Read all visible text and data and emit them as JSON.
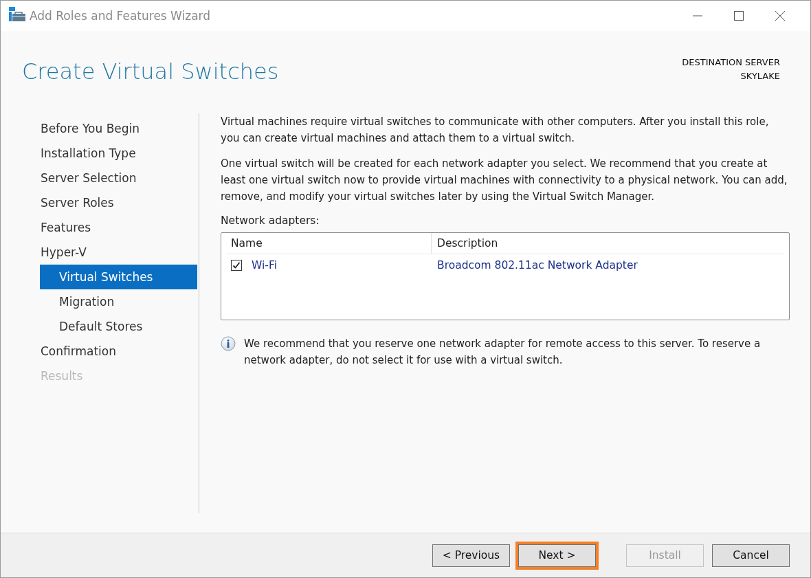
{
  "window": {
    "title": "Add Roles and Features Wizard"
  },
  "page_title": "Create Virtual Switches",
  "destination": {
    "label": "DESTINATION SERVER",
    "server": "SKYLAKE"
  },
  "nav": [
    {
      "label": "Before You Begin",
      "selected": false,
      "disabled": false
    },
    {
      "label": "Installation Type",
      "selected": false,
      "disabled": false
    },
    {
      "label": "Server Selection",
      "selected": false,
      "disabled": false
    },
    {
      "label": "Server Roles",
      "selected": false,
      "disabled": false
    },
    {
      "label": "Features",
      "selected": false,
      "disabled": false
    },
    {
      "label": "Hyper-V",
      "selected": false,
      "disabled": false,
      "children": [
        {
          "label": "Virtual Switches",
          "selected": true,
          "disabled": false
        },
        {
          "label": "Migration",
          "selected": false,
          "disabled": false
        },
        {
          "label": "Default Stores",
          "selected": false,
          "disabled": false
        }
      ]
    },
    {
      "label": "Confirmation",
      "selected": false,
      "disabled": false
    },
    {
      "label": "Results",
      "selected": false,
      "disabled": true
    }
  ],
  "paragraphs": [
    "Virtual machines require virtual switches to communicate with other computers. After you install this role, you can create virtual machines and attach them to a virtual switch.",
    "One virtual switch will be created for each network adapter you select. We recommend that you create at least one virtual switch now to provide virtual machines with connectivity to a physical network. You can add, remove, and modify your virtual switches later by using the Virtual Switch Manager."
  ],
  "adapters": {
    "label": "Network adapters:",
    "columns": [
      "Name",
      "Description"
    ],
    "rows": [
      {
        "name": "Wi-Fi",
        "description": "Broadcom 802.11ac Network Adapter",
        "checked": true
      }
    ]
  },
  "info": "We recommend that you reserve one network adapter for remote access to this server. To reserve a network adapter, do not select it for use with a virtual switch.",
  "buttons": [
    {
      "label": "< Previous",
      "disabled": false,
      "highlighted": false
    },
    {
      "label": "Next >",
      "disabled": false,
      "highlighted": true
    },
    {
      "label": "Install",
      "disabled": true,
      "highlighted": false
    },
    {
      "label": "Cancel",
      "disabled": false,
      "highlighted": false
    }
  ]
}
